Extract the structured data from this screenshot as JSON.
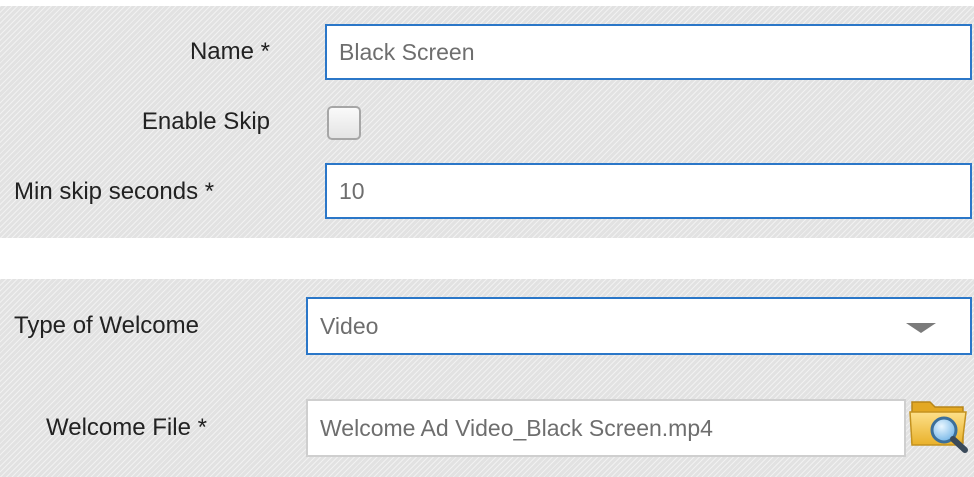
{
  "form_general": {
    "name": {
      "label": "Name *",
      "value": "Black Screen"
    },
    "enable_skip": {
      "label": "Enable Skip",
      "checked": false
    },
    "min_skip_seconds": {
      "label": "Min skip seconds *",
      "value": "10"
    }
  },
  "form_welcome": {
    "type_of_welcome": {
      "label": "Type of Welcome",
      "selected": "Video"
    },
    "welcome_file": {
      "label": "Welcome File *",
      "value": "Welcome Ad Video_Black Screen.mp4"
    }
  },
  "icons": {
    "dropdown": "chevron-down-icon",
    "browse": "folder-search-icon"
  },
  "colors": {
    "focus_border": "#2b77c8",
    "panel_bg": "#e6e6e6",
    "folder_yellow": "#f3c63d"
  }
}
